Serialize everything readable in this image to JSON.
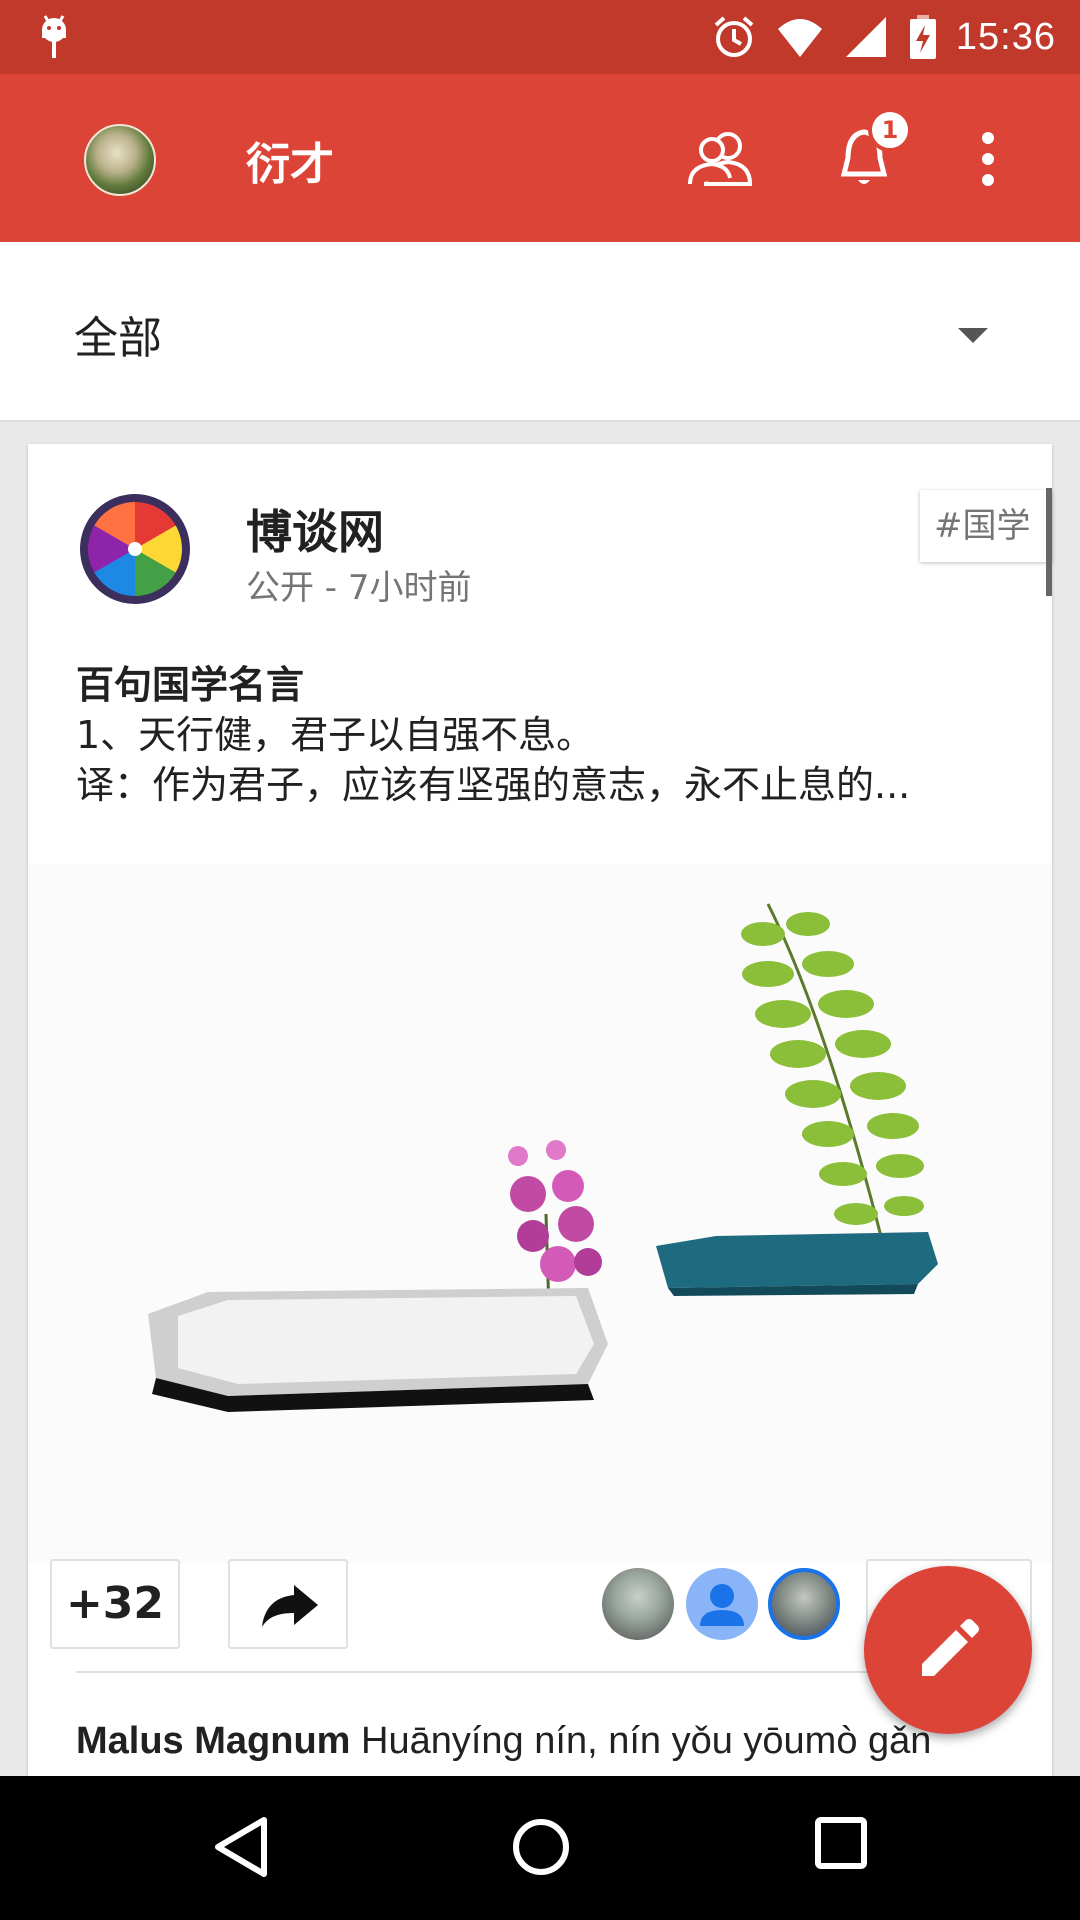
{
  "status_bar": {
    "time": "15:36",
    "icons": [
      "android-debug-icon",
      "alarm-icon",
      "wifi-icon",
      "signal-icon",
      "battery-charging-icon"
    ]
  },
  "app_bar": {
    "title": "衍才",
    "notification_count": "1",
    "icons": [
      "avatar",
      "people-icon",
      "bell-icon",
      "more-vert-icon"
    ],
    "color": "#db4437"
  },
  "filter": {
    "selected": "全部"
  },
  "post": {
    "author": "博谈网",
    "meta": "公开 - 7小时前",
    "hashtag": "#国学",
    "title": "百句国学名言",
    "line1": "1、天行健，君子以自强不息。",
    "line2": "译：作为君子，应该有坚强的意志，永不止息的...",
    "plus_count": "+32",
    "comment_author": "Malus Magnum",
    "comment_text": " Huānyíng nín, nín yǒu yōumò gǎn"
  },
  "fab": {
    "icon": "pencil-icon",
    "color": "#db4437"
  },
  "nav_bar": {
    "icons": [
      "back-icon",
      "home-icon",
      "recents-icon"
    ]
  }
}
